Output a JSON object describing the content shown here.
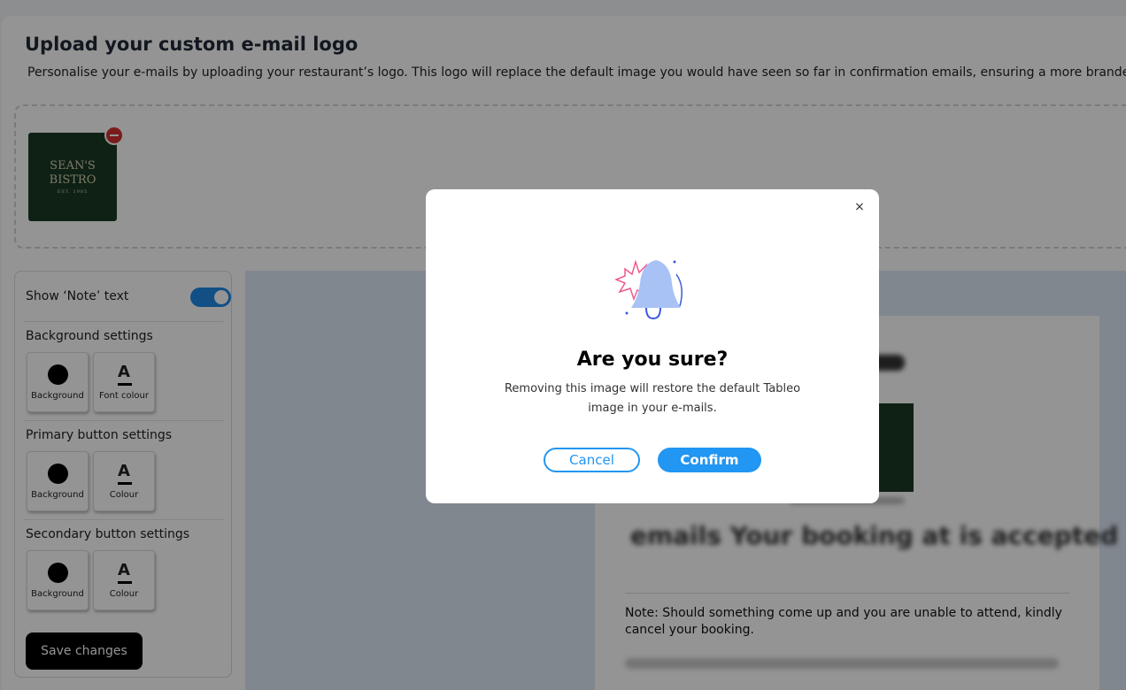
{
  "page": {
    "title": "Upload your custom e-mail logo",
    "subtitle": "Personalise your e-mails by uploading your restaurant’s logo. This logo will replace the default image you would have seen so far in confirmation emails, ensuring a more branded"
  },
  "logo": {
    "line1": "SEAN'S",
    "line2": "BISTRO",
    "line3": "EST. 1985"
  },
  "settings": {
    "show_note_label": "Show ‘Note’ text",
    "show_note_on": true,
    "background": {
      "title": "Background settings",
      "swatches": [
        {
          "label": "Background"
        },
        {
          "label": "Font colour",
          "glyph": "A"
        }
      ]
    },
    "primary": {
      "title": "Primary button settings",
      "swatches": [
        {
          "label": "Background"
        },
        {
          "label": "Colour",
          "glyph": "A"
        }
      ]
    },
    "secondary": {
      "title": "Secondary button settings",
      "swatches": [
        {
          "label": "Background"
        },
        {
          "label": "Colour",
          "glyph": "A"
        }
      ]
    },
    "save_label": "Save changes"
  },
  "preview": {
    "heading": "emails Your booking at is accepted",
    "note": "Note: Should something come up and you are unable to attend, kindly cancel your booking."
  },
  "modal": {
    "close_glyph": "×",
    "title": "Are you sure?",
    "text": "Removing this image will restore the default Tableo image in your e-mails.",
    "cancel_label": "Cancel",
    "confirm_label": "Confirm"
  },
  "colors": {
    "accent": "#2196f3",
    "danger": "#d32f2f",
    "logo_bg": "#1b3a24"
  }
}
